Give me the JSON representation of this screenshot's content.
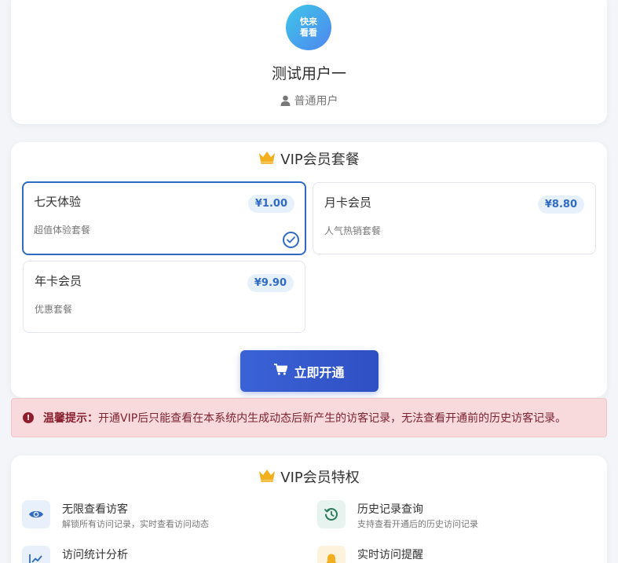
{
  "profile": {
    "avatar_line1": "快来",
    "avatar_line2": "看看",
    "username": "测试用户一",
    "role": "普通用户",
    "role_icon": "user-icon"
  },
  "packages": {
    "title": "VIP会员套餐",
    "title_icon": "crown-icon",
    "selected_index": 0,
    "plans": [
      {
        "name": "七天体验",
        "desc": "超值体验套餐",
        "price": "¥1.00"
      },
      {
        "name": "月卡会员",
        "desc": "人气热销套餐",
        "price": "¥8.80"
      },
      {
        "name": "年卡会员",
        "desc": "优惠套餐",
        "price": "¥9.90"
      }
    ],
    "button_label": "立即开通",
    "button_icon": "cart-icon"
  },
  "notice": {
    "label": "温馨提示：",
    "text": "开通VIP后只能查看在本系统内生成动态后新产生的访客记录，无法查看开通前的历史访客记录。",
    "icon": "alert-icon"
  },
  "privileges": {
    "title": "VIP会员特权",
    "title_icon": "crown-icon",
    "items": [
      {
        "title": "无限查看访客",
        "desc": "解锁所有访问记录，实时查看访问动态",
        "icon": "eye-icon"
      },
      {
        "title": "历史记录查询",
        "desc": "支持查看开通后的历史访问记录",
        "icon": "history-icon"
      },
      {
        "title": "访问统计分析",
        "desc": "",
        "icon": "chart-line-icon"
      },
      {
        "title": "实时访问提醒",
        "desc": "",
        "icon": "bell-icon"
      }
    ]
  },
  "colors": {
    "accent": "#2f6bc6",
    "button": "#3a63d6",
    "crown": "#f2b01e",
    "notice_bg": "#f8dadd",
    "notice_text": "#7c2330"
  }
}
